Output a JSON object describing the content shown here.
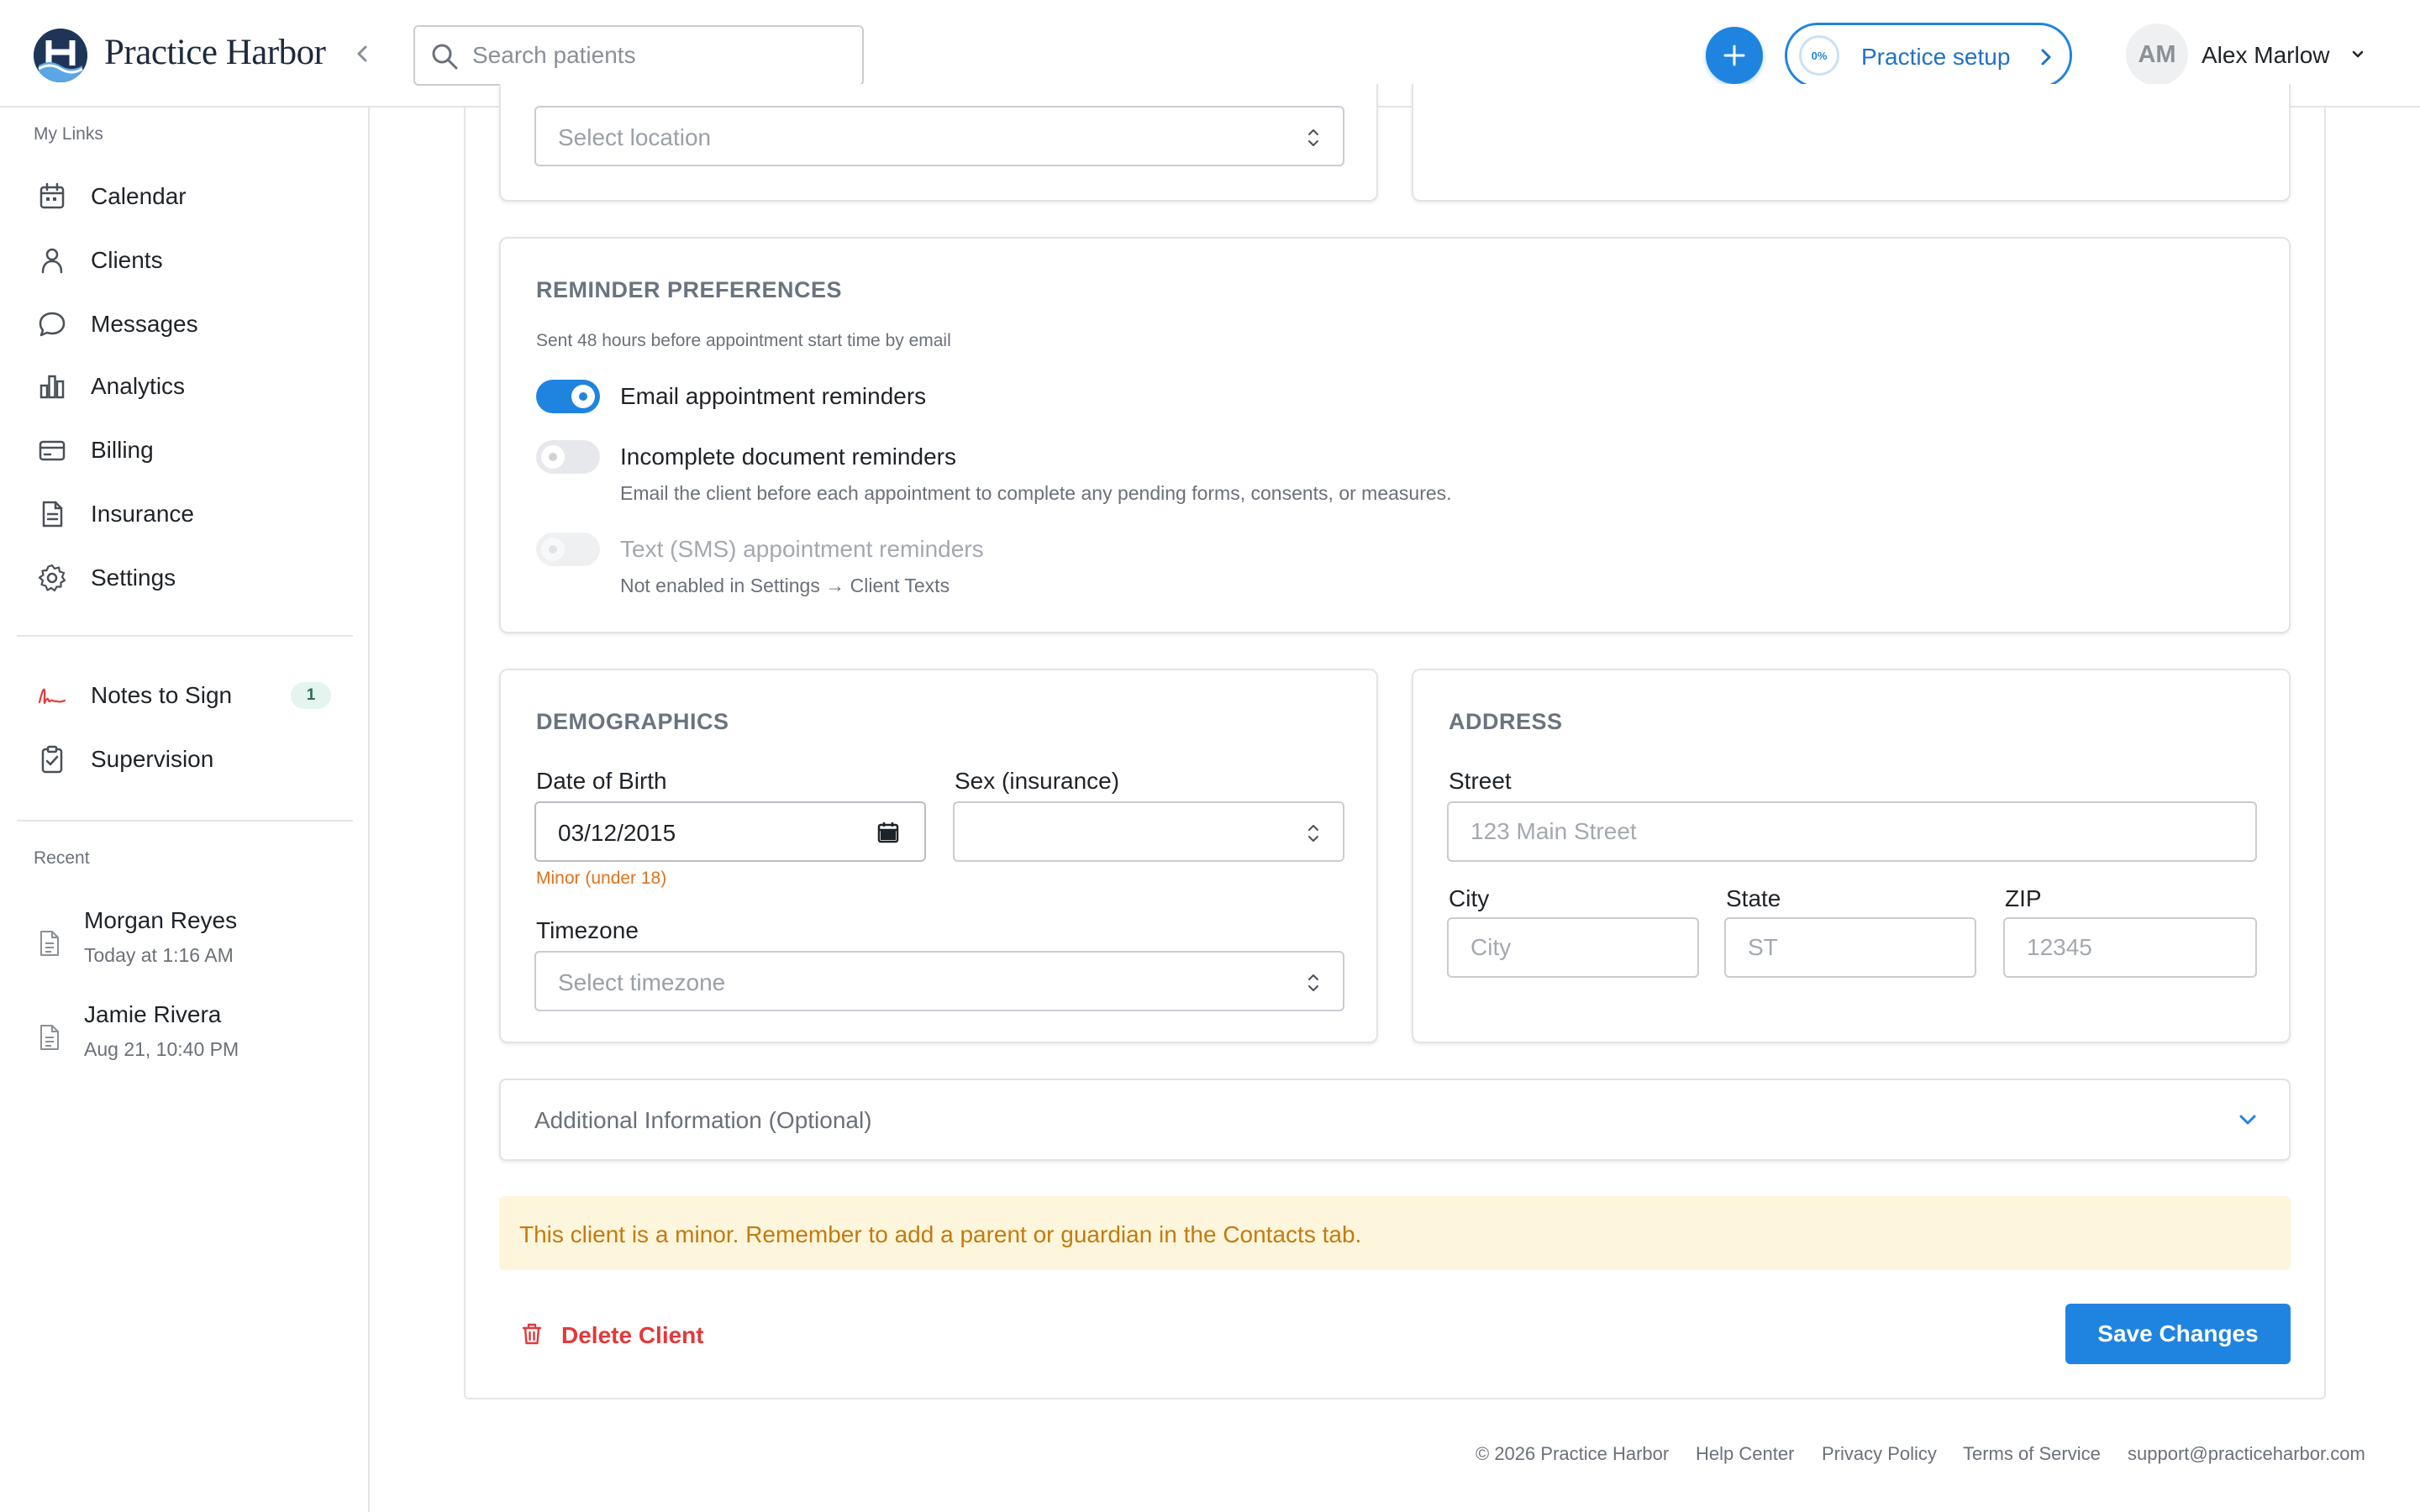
{
  "header": {
    "brand": "Practice Harbor",
    "search_placeholder": "Search patients",
    "setup_label": "Practice setup",
    "setup_progress": "0%",
    "avatar_initials": "AM",
    "user_name": "Alex Marlow"
  },
  "sidebar": {
    "links_heading": "My Links",
    "links": [
      {
        "label": "Calendar",
        "icon": "calendar-icon"
      },
      {
        "label": "Clients",
        "icon": "user-icon"
      },
      {
        "label": "Messages",
        "icon": "chat-icon"
      },
      {
        "label": "Analytics",
        "icon": "bar-chart-icon"
      },
      {
        "label": "Billing",
        "icon": "credit-card-icon"
      },
      {
        "label": "Insurance",
        "icon": "document-icon"
      },
      {
        "label": "Settings",
        "icon": "gear-icon"
      }
    ],
    "tasks": [
      {
        "label": "Notes to Sign",
        "icon": "signature-icon",
        "badge": "1"
      },
      {
        "label": "Supervision",
        "icon": "clipboard-check-icon"
      }
    ],
    "recent_heading": "Recent",
    "recent": [
      {
        "name": "Morgan Reyes",
        "time": "Today at 1:16 AM"
      },
      {
        "name": "Jamie Rivera",
        "time": "Aug 21, 10:40 PM"
      }
    ]
  },
  "location": {
    "placeholder": "Select location"
  },
  "reminders": {
    "title": "REMINDER PREFERENCES",
    "subtitle": "Sent 48 hours before appointment start time by email",
    "email_label": "Email appointment reminders",
    "email_enabled": true,
    "document_label": "Incomplete document reminders",
    "document_enabled": false,
    "document_help": "Email the client before each appointment to complete any pending forms, consents, or measures.",
    "sms_label": "Text (SMS) appointment reminders",
    "sms_enabled": false,
    "sms_help": "Not enabled in Settings → Client Texts"
  },
  "demographics": {
    "title": "DEMOGRAPHICS",
    "dob_label": "Date of Birth",
    "dob_value": "03/12/2015",
    "dob_warning": "Minor (under 18)",
    "sex_label": "Sex (insurance)",
    "sex_value": "",
    "timezone_label": "Timezone",
    "timezone_placeholder": "Select timezone"
  },
  "address": {
    "title": "ADDRESS",
    "street_label": "Street",
    "street_placeholder": "123 Main Street",
    "city_label": "City",
    "city_placeholder": "City",
    "state_label": "State",
    "state_placeholder": "ST",
    "zip_label": "ZIP",
    "zip_placeholder": "12345"
  },
  "additional": {
    "label": "Additional Information (Optional)"
  },
  "alert": {
    "text": "This client is a minor. Remember to add a parent or guardian in the Contacts tab."
  },
  "actions": {
    "delete_label": "Delete Client",
    "save_label": "Save Changes"
  },
  "footer": {
    "copyright": "© 2026 Practice Harbor",
    "links": [
      "Help Center",
      "Privacy Policy",
      "Terms of Service",
      "support@practiceharbor.com"
    ]
  },
  "colors": {
    "accent": "#1f84e0",
    "danger": "#e2393a",
    "warning": "#e0731c",
    "alert_bg": "#fdf6dc"
  }
}
